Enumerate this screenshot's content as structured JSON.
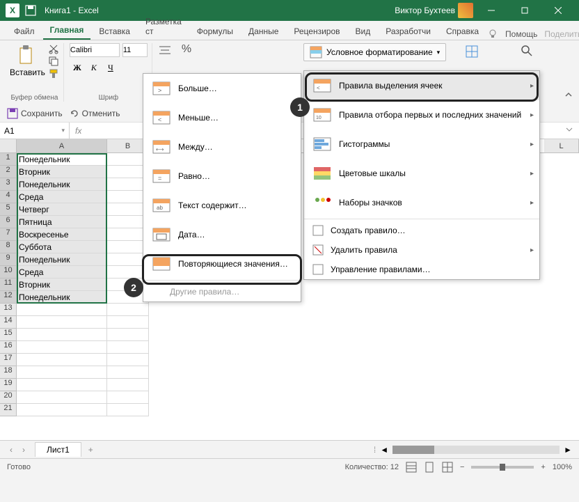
{
  "titlebar": {
    "filename": "Книга1 - Excel",
    "user": "Виктор Бухтеев"
  },
  "tabs": {
    "items": [
      "Файл",
      "Главная",
      "Вставка",
      "Разметка ст",
      "Формулы",
      "Данные",
      "Рецензиров",
      "Вид",
      "Разработчи",
      "Справка"
    ],
    "help_label": "Помощь",
    "share_label": "Поделиться",
    "active": 1
  },
  "ribbon": {
    "paste_label": "Вставить",
    "clipboard_label": "Буфер обмена",
    "font_name": "Calibri",
    "font_size": "11",
    "font_label": "Шриф",
    "cond_format_label": "Условное форматирование"
  },
  "qat": {
    "save_label": "Сохранить",
    "undo_label": "Отменить"
  },
  "namebox": {
    "cell": "A1"
  },
  "columns": [
    "A",
    "B",
    "L"
  ],
  "rows_data": [
    "Понедельник",
    "Вторник",
    "Понедельник",
    "Среда",
    "Четверг",
    "Пятница",
    "Воскресенье",
    "Суббота",
    "Понедельник",
    "Среда",
    "Вторник",
    "Понедельник"
  ],
  "row_count": 21,
  "sheet": {
    "name": "Лист1"
  },
  "statusbar": {
    "ready": "Готово",
    "count_label": "Количество: 12",
    "zoom": "100%"
  },
  "menu1": {
    "highlight_rules": "Правила выделения ячеек",
    "top_bottom": "Правила отбора первых и последних значений",
    "data_bars": "Гистограммы",
    "color_scales": "Цветовые шкалы",
    "icon_sets": "Наборы значков",
    "new_rule": "Создать правило…",
    "clear_rules": "Удалить правила",
    "manage_rules": "Управление правилами…"
  },
  "menu2": {
    "greater": "Больше…",
    "less": "Меньше…",
    "between": "Между…",
    "equal": "Равно…",
    "text_contains": "Текст содержит…",
    "date": "Дата…",
    "duplicate": "Повторяющиеся значения…",
    "more_rules": "Другие правила…"
  },
  "callouts": {
    "n1": "1",
    "n2": "2"
  }
}
